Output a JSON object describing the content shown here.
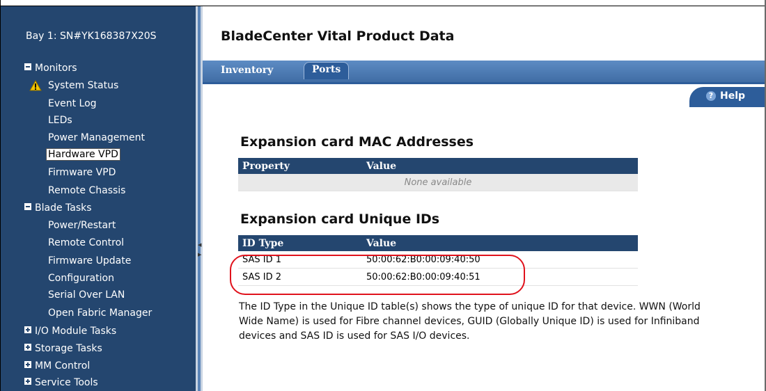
{
  "sidebar": {
    "bay_title": "Bay 1: SN#YK168387X20S",
    "groups": [
      {
        "label": "Monitors",
        "state": "expanded"
      },
      {
        "label": "Blade Tasks",
        "state": "expanded"
      },
      {
        "label": "I/O Module Tasks",
        "state": "collapsed"
      },
      {
        "label": "Storage Tasks",
        "state": "collapsed"
      },
      {
        "label": "MM Control",
        "state": "collapsed"
      },
      {
        "label": "Service Tools",
        "state": "collapsed"
      }
    ],
    "monitor_items": [
      {
        "label": "System Status",
        "icon": "warning-icon"
      },
      {
        "label": "Event Log"
      },
      {
        "label": "LEDs"
      },
      {
        "label": "Power Management"
      },
      {
        "label": "Hardware VPD",
        "active": true
      },
      {
        "label": "Firmware VPD"
      },
      {
        "label": "Remote Chassis"
      }
    ],
    "blade_items": [
      {
        "label": "Power/Restart"
      },
      {
        "label": "Remote Control"
      },
      {
        "label": "Firmware Update"
      },
      {
        "label": "Configuration"
      },
      {
        "label": "Serial Over LAN"
      },
      {
        "label": "Open Fabric Manager"
      }
    ]
  },
  "main": {
    "page_title": "BladeCenter Vital Product Data",
    "tabs": [
      {
        "label": "Inventory",
        "active": false
      },
      {
        "label": "Ports",
        "active": true
      }
    ],
    "help_label": "Help",
    "mac_section": {
      "title": "Expansion card MAC Addresses",
      "headers": [
        "Property",
        "Value"
      ],
      "empty_text": "None available"
    },
    "uid_section": {
      "title": "Expansion card Unique IDs",
      "headers": [
        "ID Type",
        "Value"
      ],
      "rows": [
        {
          "type": "SAS ID 1",
          "value": "50:00:62:B0:00:09:40:50"
        },
        {
          "type": "SAS ID 2",
          "value": "50:00:62:B0:00:09:40:51"
        }
      ]
    },
    "note": "The ID Type in the Unique ID table(s) shows the type of unique ID for that device. WWN (World Wide Name) is used for Fibre channel devices, GUID (Globally Unique ID) is used for Infiniband devices and SAS ID is used for SAS I/O devices."
  },
  "colors": {
    "sidebar_bg": "#24466f",
    "tab_bar": "#4a78b2",
    "table_header": "#24466f",
    "highlight_oval": "#e0121c"
  }
}
